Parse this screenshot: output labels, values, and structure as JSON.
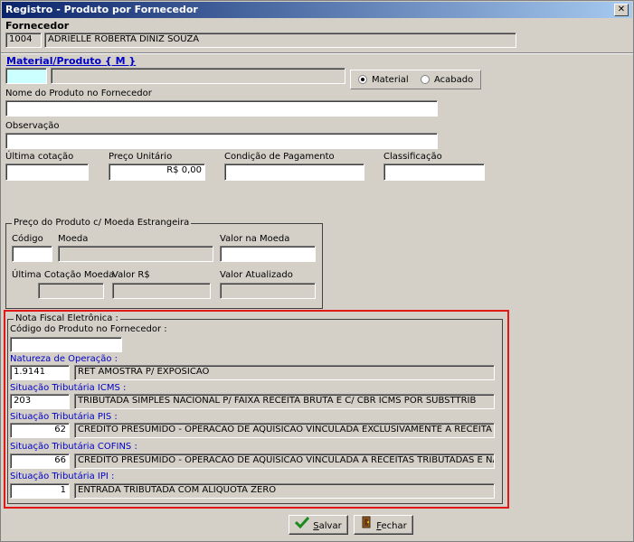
{
  "window": {
    "title": "Registro - Produto por Fornecedor",
    "close_glyph": "✕"
  },
  "fornecedor": {
    "label": "Fornecedor",
    "code": "1004",
    "name": "ADRIELLE ROBERTA DINIZ SOUZA"
  },
  "material": {
    "label": "Material/Produto",
    "suffix": "{ M }",
    "code": "",
    "description": "",
    "radio_material": "Material",
    "radio_acabado": "Acabado",
    "selected": "Material"
  },
  "nome_produto": {
    "label": "Nome do Produto no Fornecedor",
    "value": ""
  },
  "observacao": {
    "label": "Observação",
    "value": ""
  },
  "ultima_cotacao": {
    "label": "Última cotação",
    "value": ""
  },
  "preco_unitario": {
    "label": "Preço Unitário",
    "value": "R$ 0,00"
  },
  "condicao_pagamento": {
    "label": "Condição de Pagamento",
    "value": ""
  },
  "classificacao": {
    "label": "Classificação",
    "value": ""
  },
  "moeda_estrangeira": {
    "title": "Preço do Produto c/ Moeda Estrangeira",
    "codigo_label": "Código",
    "moeda_label": "Moeda",
    "valor_moeda_label": "Valor na Moeda",
    "ultima_cotacao_moeda_label": "Última Cotação Moeda",
    "valor_rs_label": "Valor R$",
    "valor_atualizado_label": "Valor Atualizado"
  },
  "nfe": {
    "title": "Nota Fiscal Eletrônica :",
    "codigo_produto_label": "Código do Produto no Fornecedor :",
    "codigo_produto": "",
    "natureza_label": "Natureza de Operação :",
    "natureza_code": "1.9141",
    "natureza_desc": "RET AMOSTRA P/ EXPOSICAO",
    "icms_label": "Situação Tributária ICMS :",
    "icms_code": "203",
    "icms_desc": "TRIBUTADA SIMPLES NACIONAL P/ FAIXA RECEITA BRUTA E C/ CBR ICMS POR SUBSTTRIB",
    "pis_label": "Situação Tributária PIS :",
    "pis_code": "62",
    "pis_desc": "CREDITO PRESUMIDO - OPERACAO DE AQUISICAO VINCULADA EXCLUSIVAMENTE A RECEITA DE E",
    "cofins_label": "Situação Tributária COFINS :",
    "cofins_code": "66",
    "cofins_desc": "CREDITO PRESUMIDO - OPERACAO DE AQUISICAO VINCULADA A RECEITAS TRIBUTADAS E NAO-T",
    "ipi_label": "Situação Tributária IPI :",
    "ipi_code": "1",
    "ipi_desc": "ENTRADA TRIBUTADA COM ALIQUOTA ZERO"
  },
  "buttons": {
    "salvar_mnemonic": "S",
    "salvar_rest": "alvar",
    "fechar_mnemonic": "F",
    "fechar_rest": "echar"
  },
  "colors": {
    "highlight_border": "#e01818",
    "link_blue": "#0000c8",
    "focus_field": "#ccffff"
  }
}
